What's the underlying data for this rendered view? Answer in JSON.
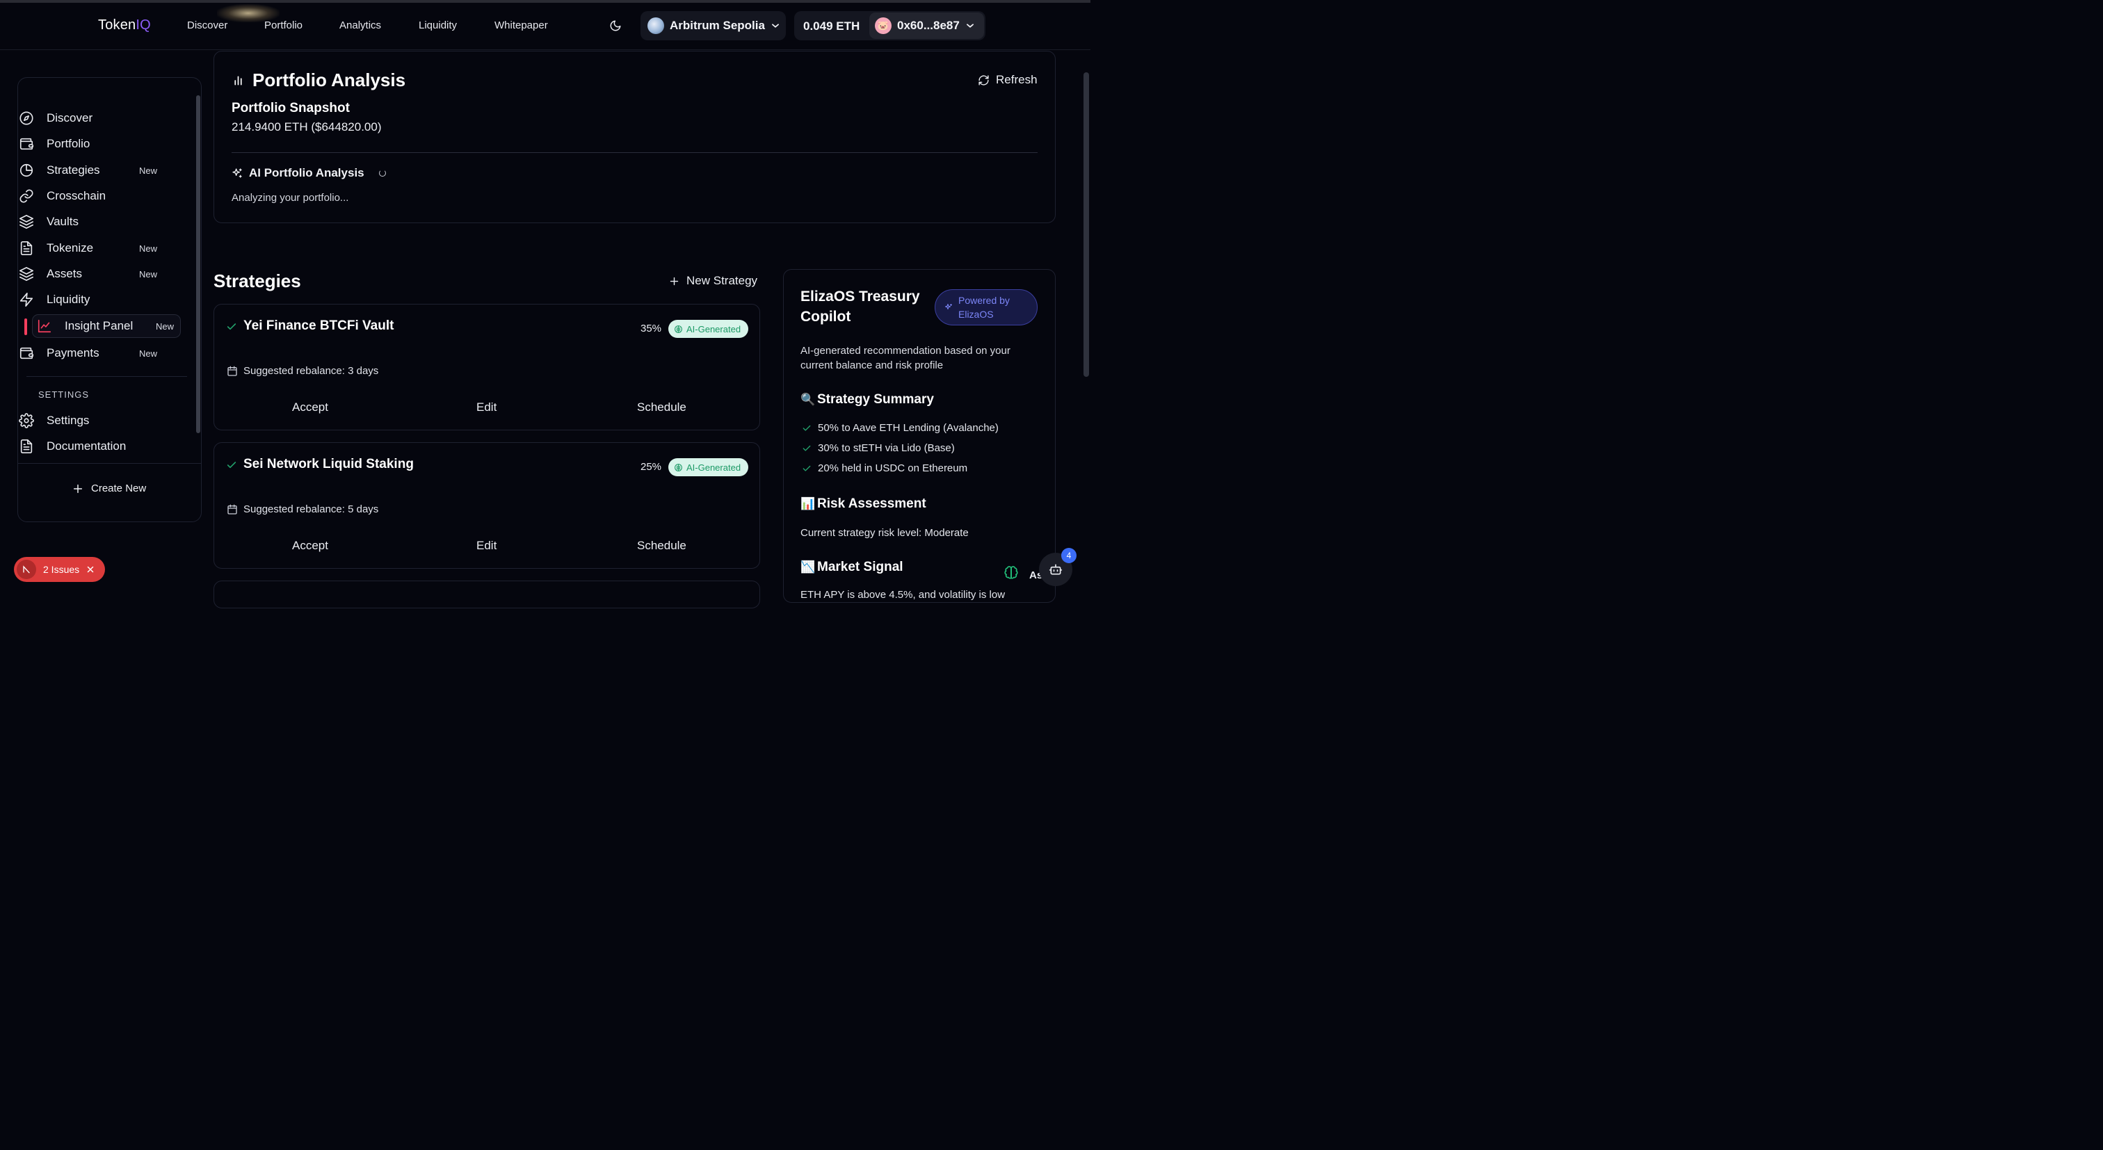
{
  "app": {
    "logo_prefix": "Token",
    "logo_suffix": "IQ",
    "accent": "#8b5cf6"
  },
  "nav": {
    "links": [
      "Discover",
      "Portfolio",
      "Analytics",
      "Liquidity",
      "Whitepaper"
    ],
    "theme_icon": "moon-icon",
    "chain": "Arbitrum Sepolia",
    "balance": "0.049 ETH",
    "account": "0x60...8e87"
  },
  "sidebar": {
    "items": [
      {
        "label": "Discover",
        "badge": "",
        "icon": "compass-icon"
      },
      {
        "label": "Portfolio",
        "badge": "",
        "icon": "wallet-icon"
      },
      {
        "label": "Strategies",
        "badge": "New",
        "icon": "pie-chart-icon"
      },
      {
        "label": "Crosschain",
        "badge": "",
        "icon": "link-icon"
      },
      {
        "label": "Vaults",
        "badge": "",
        "icon": "layers-icon"
      },
      {
        "label": "Tokenize",
        "badge": "New",
        "icon": "file-text-icon"
      },
      {
        "label": "Assets",
        "badge": "New",
        "icon": "layers-icon"
      },
      {
        "label": "Liquidity",
        "badge": "",
        "icon": "zap-icon"
      },
      {
        "label": "Insight Panel",
        "badge": "New",
        "icon": "line-chart-icon",
        "active": true
      },
      {
        "label": "Payments",
        "badge": "New",
        "icon": "wallet-icon"
      }
    ],
    "settings_section": "SETTINGS",
    "settings_items": [
      {
        "label": "Settings",
        "icon": "gear-icon"
      },
      {
        "label": "Documentation",
        "icon": "file-text-icon"
      }
    ],
    "create_new": "Create New",
    "active_color": "#f43f5e"
  },
  "issues": {
    "label": "2 Issues",
    "color": "#dc3b3b"
  },
  "portfolio_analysis": {
    "title": "Portfolio Analysis",
    "refresh": "Refresh",
    "snapshot_title": "Portfolio Snapshot",
    "snapshot_value": "214.9400 ETH ($644820.00)",
    "ai_title": "AI Portfolio Analysis",
    "ai_status": "Analyzing your portfolio..."
  },
  "strategies": {
    "heading": "Strategies",
    "new_button": "New Strategy",
    "cards": [
      {
        "name": "Yei Finance BTCFi Vault",
        "percent": "35%",
        "badge": "AI-Generated",
        "rebalance": "Suggested rebalance: 3 days",
        "actions": [
          "Accept",
          "Edit",
          "Schedule"
        ]
      },
      {
        "name": "Sei Network Liquid Staking",
        "percent": "25%",
        "badge": "AI-Generated",
        "rebalance": "Suggested rebalance: 5 days",
        "actions": [
          "Accept",
          "Edit",
          "Schedule"
        ]
      }
    ]
  },
  "copilot": {
    "title": "ElizaOS Treasury Copilot",
    "powered_by": "Powered by ElizaOS",
    "description": "AI-generated recommendation based on your current balance and risk profile",
    "summary_heading": "Strategy Summary",
    "summary_emoji": "🔍",
    "summary_items": [
      "50% to Aave ETH Lending (Avalanche)",
      "30% to stETH via Lido (Base)",
      "20% held in USDC on Ethereum"
    ],
    "risk_heading": "Risk Assessment",
    "risk_emoji": "📊",
    "risk_text": "Current strategy risk level: Moderate",
    "market_heading": "Market Signal",
    "market_emoji": "📉",
    "market_text": "ETH APY is above 4.5%, and volatility is low"
  },
  "assistant": {
    "label": "As",
    "badge_count": "4"
  }
}
